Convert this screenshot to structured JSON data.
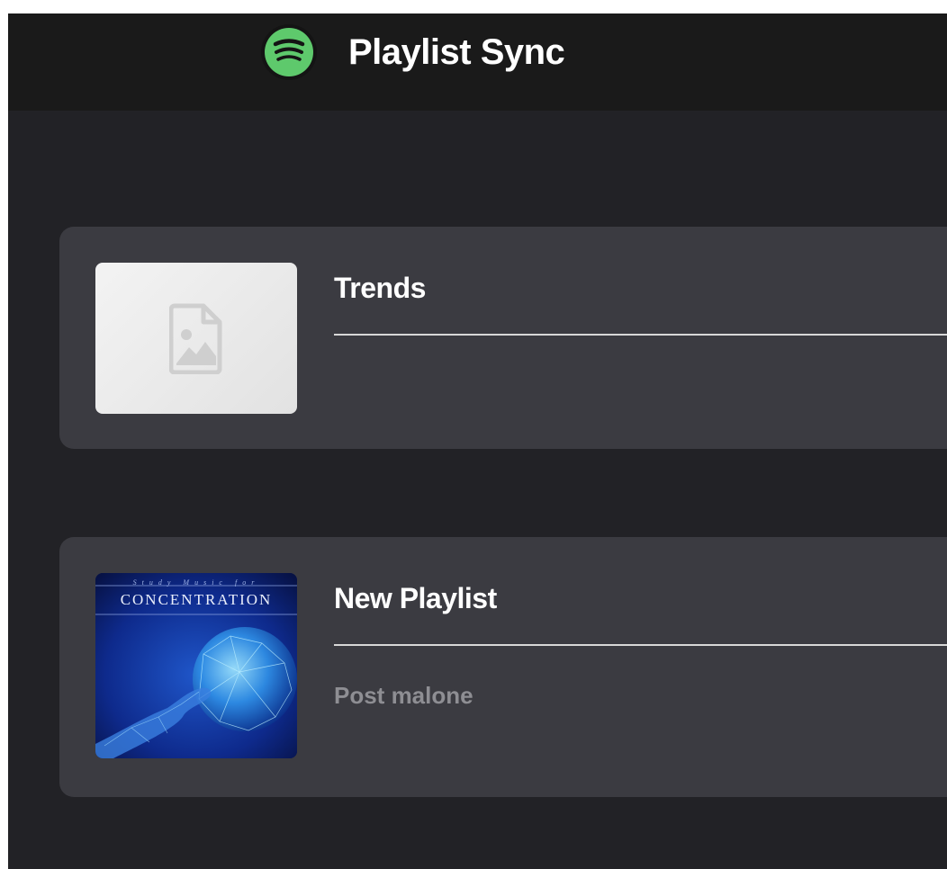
{
  "header": {
    "logo_icon": "spotify-logo-icon",
    "app_title": "Playlist Sync"
  },
  "playlists": [
    {
      "title": "Trends",
      "description": "",
      "cover_icon": "image-placeholder-icon"
    },
    {
      "title": "New Playlist",
      "description": "Post malone",
      "cover_icon": "album-cover-image",
      "cover_text_top": "Study Music for",
      "cover_text_main": "CONCENTRATION"
    }
  ],
  "colors": {
    "background": "#222226",
    "topbar": "#1a1a1a",
    "card": "#3b3b41",
    "accent_green": "#5ec96c",
    "text_primary": "#ffffff",
    "text_muted": "#8e8e93"
  }
}
